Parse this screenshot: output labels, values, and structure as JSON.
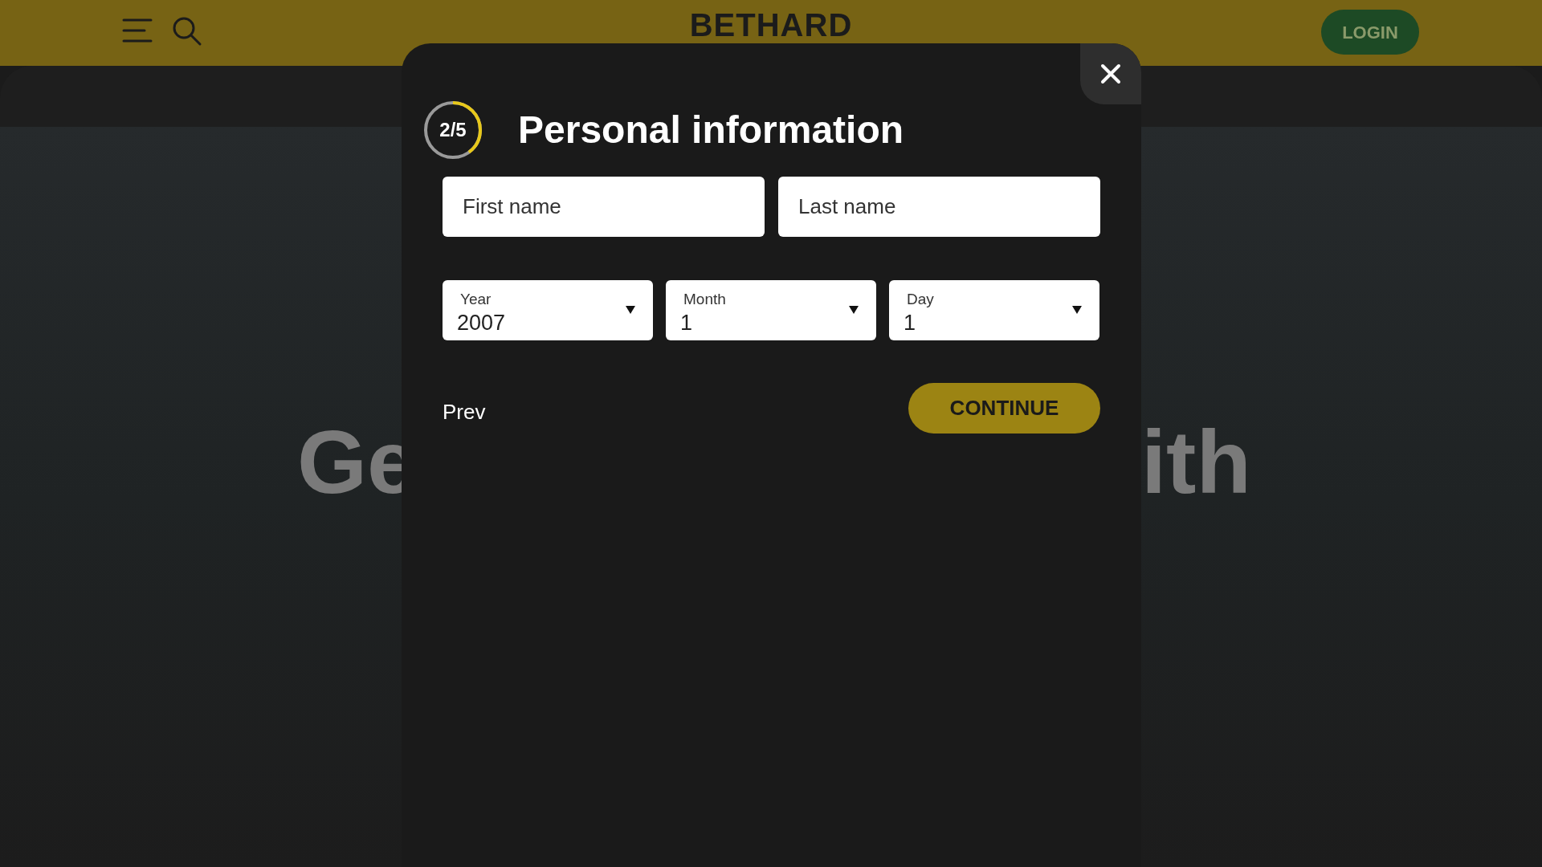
{
  "header": {
    "logo": "BETHARD",
    "login": "LOGIN"
  },
  "hero": {
    "left_text": "Ge",
    "right_text": "ith"
  },
  "modal": {
    "step": {
      "label": "2/5",
      "level": 0.4
    },
    "title": "Personal information",
    "name_fields": [
      {
        "placeholder": "First name"
      },
      {
        "placeholder": "Last name"
      }
    ],
    "date_selects": [
      {
        "label": "Year",
        "value": "2007"
      },
      {
        "label": "Month",
        "value": "1"
      },
      {
        "label": "Day",
        "value": "1"
      }
    ],
    "prev": "Prev",
    "continue": "CONTINUE"
  }
}
